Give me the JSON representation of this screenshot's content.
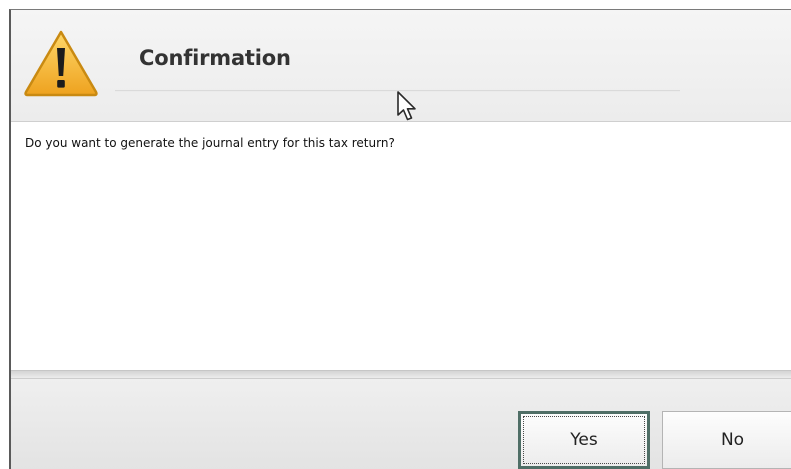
{
  "dialog": {
    "icon": "warning-icon",
    "title": "Confirmation",
    "message": "Do you want to generate the journal entry for this tax return?",
    "buttons": {
      "yes_label": "Yes",
      "no_label": "No"
    }
  },
  "colors": {
    "warning_fill": "#f2b233",
    "warning_outline": "#c98a12",
    "yes_focus_border": "#4f6e66"
  }
}
